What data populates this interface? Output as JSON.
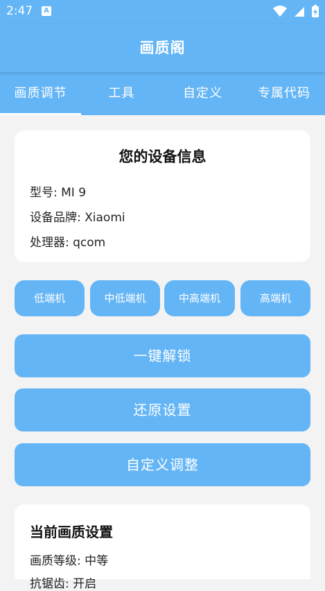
{
  "status_bar": {
    "time": "2:47",
    "notif_icon": "A"
  },
  "app_bar": {
    "title": "画质阁"
  },
  "tabs": [
    "画质调节",
    "工具",
    "自定义",
    "专属代码"
  ],
  "device_card": {
    "title": "您的设备信息",
    "rows": [
      {
        "label": "型号: ",
        "value": "MI 9"
      },
      {
        "label": "设备品牌: ",
        "value": "Xiaomi"
      },
      {
        "label": "处理器: ",
        "value": "qcom"
      }
    ]
  },
  "tier_buttons": [
    "低端机",
    "中低端机",
    "中高端机",
    "高端机"
  ],
  "action_buttons": [
    "一键解锁",
    "还原设置",
    "自定义调整"
  ],
  "current_card": {
    "title": "当前画质设置",
    "rows": [
      {
        "label": "画质等级: ",
        "value": "中等"
      },
      {
        "label": "抗锯齿: ",
        "value": "开启"
      }
    ]
  },
  "colors": {
    "accent": "#64b5f6",
    "background": "#f3f3f3"
  },
  "icons": [
    "wifi-icon",
    "signal-icon",
    "battery-charging-icon",
    "notification-a-icon"
  ]
}
